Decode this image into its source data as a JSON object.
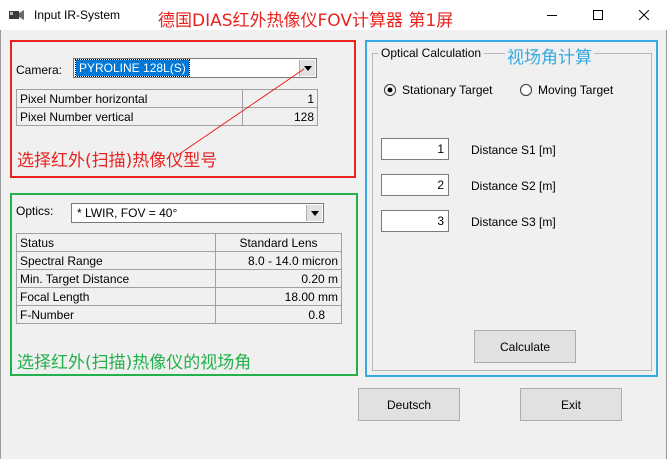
{
  "window": {
    "title": "Input IR-System",
    "annotation": "德国DIAS红外热像仪FOV计算器 第1屏",
    "minimize_glyph": "—",
    "maximize_glyph": "☐",
    "close_glyph": "✕"
  },
  "camera": {
    "label": "Camera:",
    "selected": "PYROLINE 128L(S)",
    "table": [
      {
        "name": "Pixel Number horizontal",
        "value": "1"
      },
      {
        "name": "Pixel Number vertical",
        "value": "128"
      }
    ],
    "annotation": "选择红外(扫描)热像仪型号"
  },
  "optics": {
    "label": "Optics:",
    "selected": "* LWIR, FOV = 40°",
    "table": [
      {
        "name": "Status",
        "value": "Standard Lens"
      },
      {
        "name": "Spectral Range",
        "value": "8.0 - 14.0 micron"
      },
      {
        "name": "Min. Target Distance",
        "value": "0.20 m"
      },
      {
        "name": "Focal Length",
        "value": "18.00 mm"
      },
      {
        "name": "F-Number",
        "value": "0.8"
      }
    ],
    "annotation": "选择红外(扫描)热像仪的视场角"
  },
  "calc": {
    "legend": "Optical Calculation",
    "annotation": "视场角计算",
    "radio_stationary": "Stationary Target",
    "radio_moving": "Moving Target",
    "selected_mode": "Stationary Target",
    "distances": [
      {
        "value": "1",
        "label": "Distance S1 [m]"
      },
      {
        "value": "2",
        "label": "Distance S2 [m]"
      },
      {
        "value": "3",
        "label": "Distance S3 [m]"
      }
    ],
    "calculate_label": "Calculate"
  },
  "footer": {
    "deutsch_label": "Deutsch",
    "exit_label": "Exit"
  },
  "colors": {
    "annotation_red": "#e8231f",
    "annotation_green": "#22b14c",
    "annotation_blue": "#36a9e1",
    "selection_blue": "#0078d7"
  }
}
